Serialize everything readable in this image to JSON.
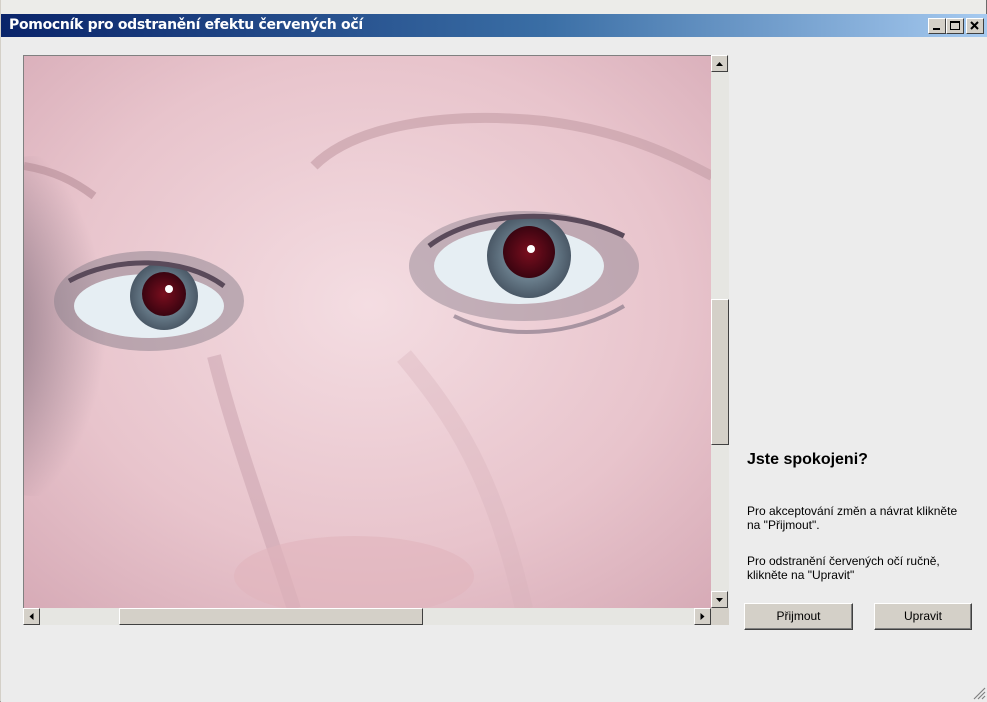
{
  "window": {
    "title": "Pomocník pro odstranění efektu červených očí",
    "controls": [
      "minimize",
      "maximize",
      "close"
    ]
  },
  "preview": {
    "icons": [
      "photo-preview"
    ],
    "colors": {
      "skin": "#e8c8cf",
      "eye_red": "#5a0a14",
      "iris": "#8a9aaa"
    }
  },
  "panel": {
    "question": "Jste spokojeni?",
    "accept_info": "Pro akceptování změn a návrat klikněte na \"Přijmout\".",
    "manual_info": "Pro odstranění červených očí ručně, klikněte na \"Upravit\""
  },
  "buttons": {
    "accept_label": "Přijmout",
    "edit_label": "Upravit"
  }
}
